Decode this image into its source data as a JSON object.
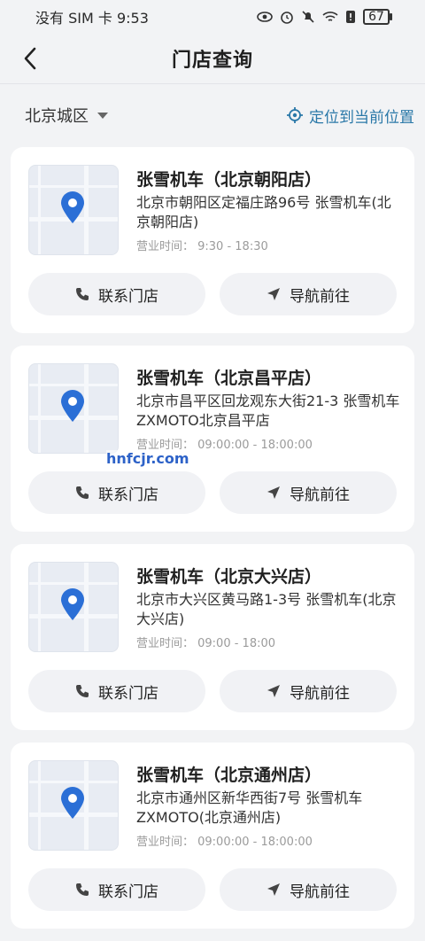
{
  "status_bar": {
    "carrier_time": "没有 SIM 卡 9:53",
    "battery": "67",
    "icons": [
      "eye-icon",
      "alarm-icon",
      "mute-icon",
      "wifi-icon",
      "alert-icon",
      "battery-icon"
    ]
  },
  "header": {
    "title": "门店查询"
  },
  "location": {
    "city": "北京城区",
    "locate_label": "定位到当前位置",
    "accent": "#2a78a8"
  },
  "stores": [
    {
      "name": "张雪机车（北京朝阳店）",
      "address": "北京市朝阳区定福庄路96号 张雪机车(北京朝阳店)",
      "hours": "营业时间：  9:30 - 18:30",
      "call_label": "联系门店",
      "nav_label": "导航前往"
    },
    {
      "name": "张雪机车（北京昌平店）",
      "address": "北京市昌平区回龙观东大街21-3 张雪机车ZXMOTO北京昌平店",
      "hours": "营业时间：  09:00:00 - 18:00:00",
      "call_label": "联系门店",
      "nav_label": "导航前往"
    },
    {
      "name": "张雪机车（北京大兴店）",
      "address": "北京市大兴区黄马路1-3号 张雪机车(北京大兴店)",
      "hours": "营业时间：  09:00 - 18:00",
      "call_label": "联系门店",
      "nav_label": "导航前往"
    },
    {
      "name": "张雪机车（北京通州店）",
      "address": "北京市通州区新华西街7号 张雪机车ZXMOTO(北京通州店)",
      "hours": "营业时间：  09:00:00 - 18:00:00",
      "call_label": "联系门店",
      "nav_label": "导航前往"
    }
  ],
  "watermark": "hnfcjr.com",
  "colors": {
    "pin": "#2b6fd6",
    "background": "#f2f3f5"
  }
}
